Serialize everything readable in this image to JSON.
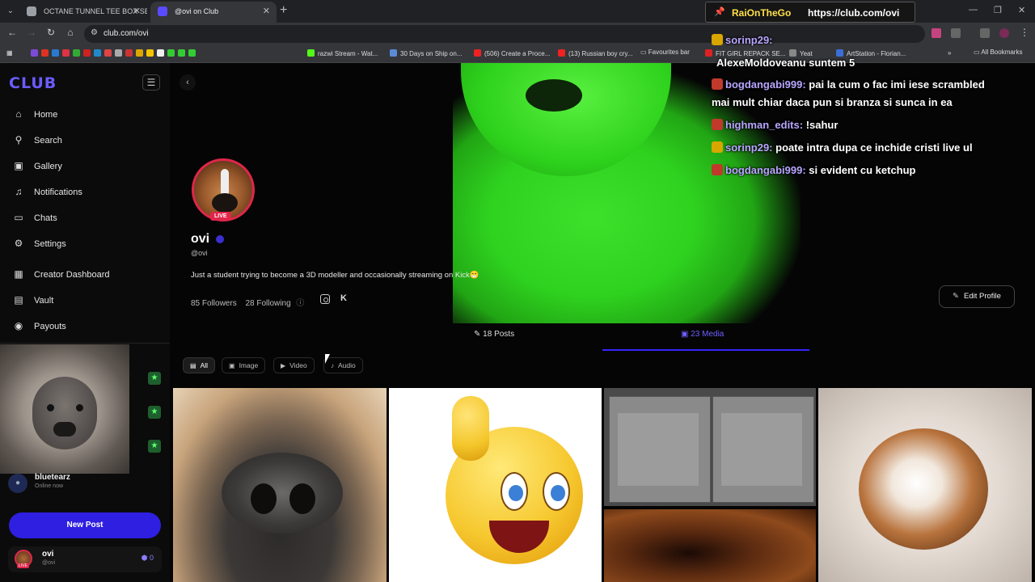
{
  "browser": {
    "tabs": [
      {
        "title": "OCTANE TUNNEL TEE BOX SET",
        "favicon_color": "#9aa0a6"
      },
      {
        "title": "@ovi on Club",
        "favicon_color": "#5b4bff"
      }
    ],
    "url": "club.com/ovi",
    "bookmarks": [
      "razwi Stream - Wat...",
      "30 Days on Ship on...",
      "(506) Create a Proce...",
      "(13) Russian boy cry...",
      "Favourites bar",
      "FIT GIRL REPACK SE...",
      "Yeat",
      "ArtStation - Florian...",
      "All Bookmarks"
    ]
  },
  "sidebar": {
    "logo": "CLUB",
    "nav": [
      {
        "label": "Home",
        "icon": "home-icon",
        "glyph": "⌂"
      },
      {
        "label": "Search",
        "icon": "search-icon",
        "glyph": "⚲"
      },
      {
        "label": "Gallery",
        "icon": "gallery-icon",
        "glyph": "▣"
      },
      {
        "label": "Notifications",
        "icon": "bell-icon",
        "glyph": "♫"
      },
      {
        "label": "Chats",
        "icon": "chat-icon",
        "glyph": "▭"
      },
      {
        "label": "Settings",
        "icon": "gear-icon",
        "glyph": "⚙"
      },
      {
        "label": "Creator Dashboard",
        "icon": "dashboard-icon",
        "glyph": "▦"
      },
      {
        "label": "Vault",
        "icon": "vault-icon",
        "glyph": "▤"
      },
      {
        "label": "Payouts",
        "icon": "payouts-icon",
        "glyph": "◉"
      }
    ],
    "online_user": {
      "name": "bluetearz",
      "status": "Online now"
    },
    "new_post": "New Post",
    "me": {
      "name": "ovi",
      "handle": "@ovi",
      "badge_count": "0",
      "live": "LIVE"
    }
  },
  "profile": {
    "live": "LIVE",
    "name": "ovi",
    "handle": "@ovi",
    "bio": "Just a student trying to become a 3D modeller and occasionally streaming on Kick😁",
    "followers": "85 Followers",
    "following": "28 Following",
    "edit_profile": "Edit Profile",
    "tabs": {
      "posts": "18 Posts",
      "media": "23 Media"
    },
    "filters": [
      "All",
      "Image",
      "Video",
      "Audio"
    ]
  },
  "overlay": {
    "streamer": "RaiOnTheGo",
    "link": "https://club.com/ovi"
  },
  "chat": [
    {
      "user": "sorinp29:",
      "text": "",
      "badge_color": "#d9a600"
    },
    {
      "user": "",
      "text": "AlexeMoldoveanu  suntem 5",
      "badge_color": ""
    },
    {
      "user": "bogdangabi999:",
      "text": " pai la cum o fac imi iese scrambled",
      "badge_color": "#c0392b"
    },
    {
      "user": "",
      "text": "mai mult chiar daca pun si branza si sunca in ea",
      "badge_color": ""
    },
    {
      "user": "highman_edits:",
      "text": " !sahur",
      "badge_color": "#c0392b"
    },
    {
      "user": "sorinp29:",
      "text": " poate intra dupa ce inchide cristi live ul",
      "badge_color": "#d9a600"
    },
    {
      "user": "bogdangabi999:",
      "text": " si evident cu ketchup",
      "badge_color": "#c0392b"
    }
  ]
}
